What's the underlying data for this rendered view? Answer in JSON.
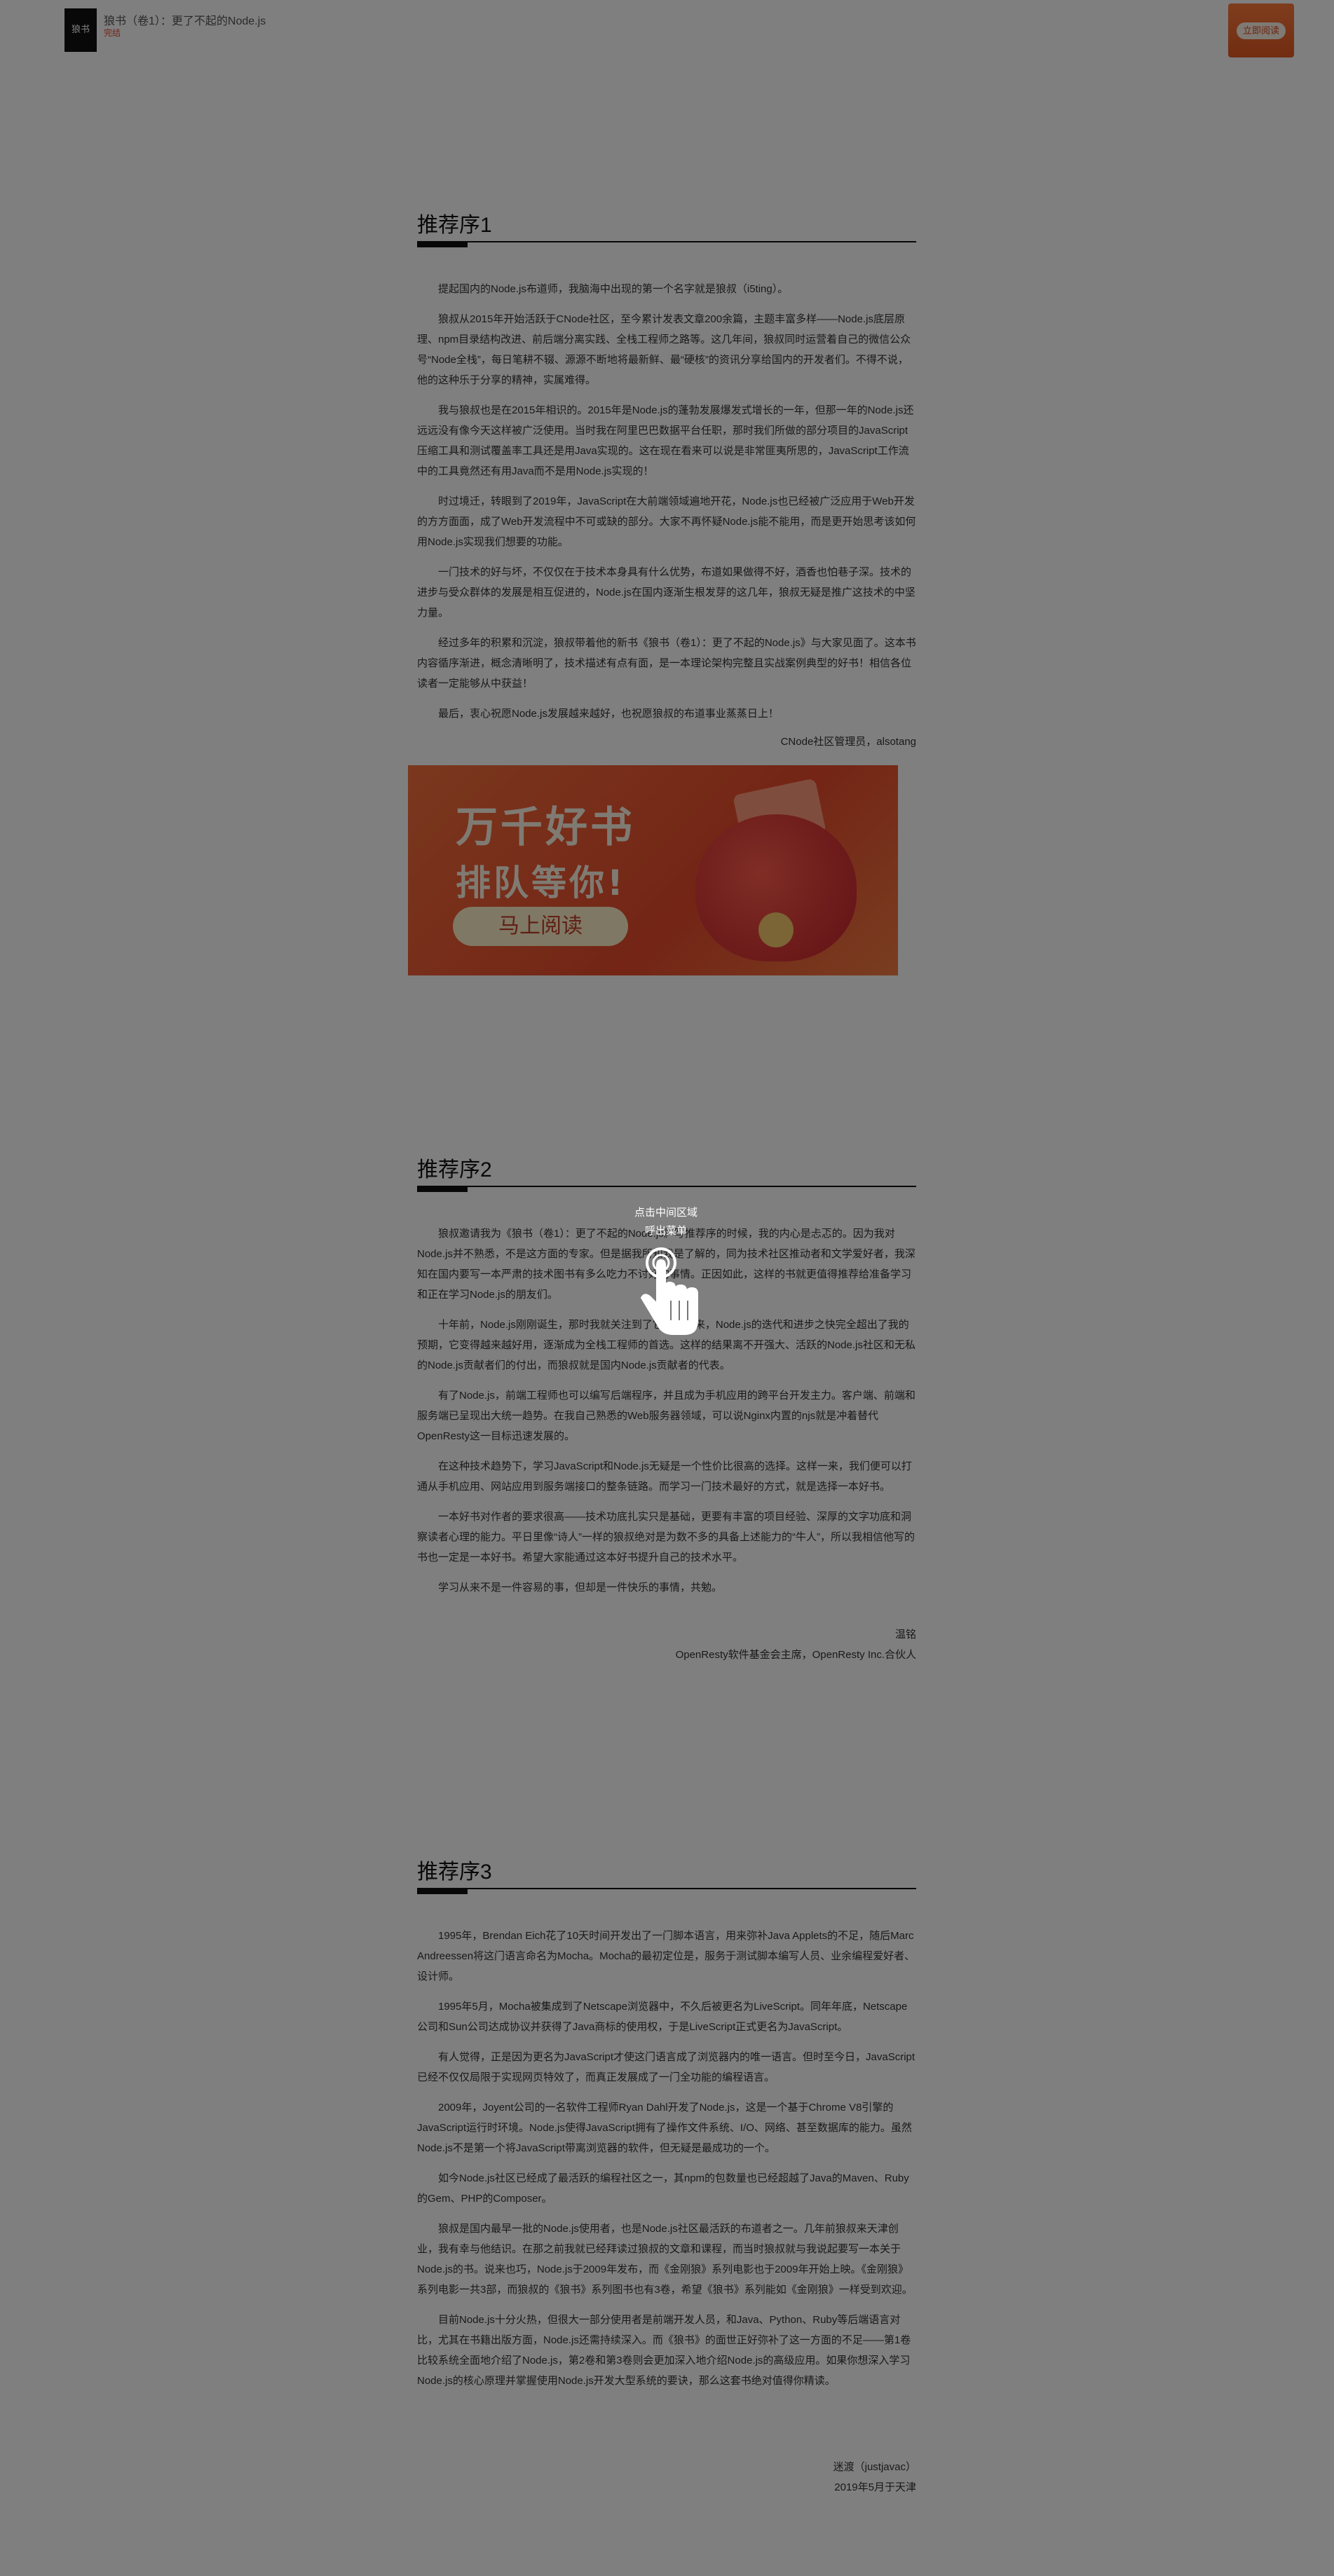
{
  "header": {
    "cover_text": "狼书",
    "title": "狼书（卷1）：更了不起的Node.js",
    "tag": "完结",
    "read_button": "立即阅读"
  },
  "sections": [
    {
      "heading": "推荐序1",
      "paragraphs": [
        "提起国内的Node.js布道师，我脑海中出现的第一个名字就是狼叔（i5ting）。",
        "狼叔从2015年开始活跃于CNode社区，至今累计发表文章200余篇，主题丰富多样——Node.js底层原理、npm目录结构改进、前后端分离实践、全栈工程师之路等。这几年间，狼叔同时运营着自己的微信公众号“Node全栈”，每日笔耕不辍、源源不断地将最新鲜、最“硬核”的资讯分享给国内的开发者们。不得不说，他的这种乐于分享的精神，实属难得。",
        "我与狼叔也是在2015年相识的。2015年是Node.js的蓬勃发展爆发式增长的一年，但那一年的Node.js还远远没有像今天这样被广泛使用。当时我在阿里巴巴数据平台任职，那时我们所做的部分项目的JavaScript压缩工具和测试覆盖率工具还是用Java实现的。这在现在看来可以说是非常匪夷所思的，JavaScript工作流中的工具竟然还有用Java而不是用Node.js实现的！",
        "时过境迁，转眼到了2019年，JavaScript在大前端领域遍地开花，Node.js也已经被广泛应用于Web开发的方方面面，成了Web开发流程中不可或缺的部分。大家不再怀疑Node.js能不能用，而是更开始思考该如何用Node.js实现我们想要的功能。",
        "一门技术的好与坏，不仅仅在于技术本身具有什么优势，布道如果做得不好，酒香也怕巷子深。技术的进步与受众群体的发展是相互促进的，Node.js在国内逐渐生根发芽的这几年，狼叔无疑是推广这技术的中坚力量。",
        "经过多年的积累和沉淀，狼叔带着他的新书《狼书（卷1）：更了不起的Node.js》与大家见面了。这本书内容循序渐进，概念清晰明了，技术描述有点有面，是一本理论架构完整且实战案例典型的好书！相信各位读者一定能够从中获益！",
        "最后，衷心祝愿Node.js发展越来越好，也祝愿狼叔的布道事业蒸蒸日上！"
      ],
      "signature": [
        "CNode社区管理员，alsotang"
      ]
    },
    {
      "heading": "推荐序2",
      "paragraphs": [
        "狼叔邀请我为《狼书（卷1）：更了不起的Node.js》写推荐序的时候，我的内心是忐忑的。因为我对Node.js并不熟悉，不是这方面的专家。但是据我所知我是了解的，同为技术社区推动者和文学爱好者，我深知在国内要写一本严肃的技术图书有多么吃力不讨好的事情。正因如此，这样的书就更值得推荐给准备学习和正在学习Node.js的朋友们。",
        "十年前，Node.js刚刚诞生，那时我就关注到了它。十年来，Node.js的迭代和进步之快完全超出了我的预期，它变得越来越好用，逐渐成为全栈工程师的首选。这样的结果离不开强大、活跃的Node.js社区和无私的Node.js贡献者们的付出，而狼叔就是国内Node.js贡献者的代表。",
        "有了Node.js，前端工程师也可以编写后端程序，并且成为手机应用的跨平台开发主力。客户端、前端和服务端已呈现出大统一趋势。在我自己熟悉的Web服务器领域，可以说Nginx内置的njs就是冲着替代OpenResty这一目标迅速发展的。",
        "在这种技术趋势下，学习JavaScript和Node.js无疑是一个性价比很高的选择。这样一来，我们便可以打通从手机应用、网站应用到服务端接口的整条链路。而学习一门技术最好的方式，就是选择一本好书。",
        "一本好书对作者的要求很高——技术功底扎实只是基础，更要有丰富的项目经验、深厚的文字功底和洞察读者心理的能力。平日里像“诗人”一样的狼叔绝对是为数不多的具备上述能力的“牛人”，所以我相信他写的书也一定是一本好书。希望大家能通过这本好书提升自己的技术水平。",
        "学习从来不是一件容易的事，但却是一件快乐的事情，共勉。"
      ],
      "signature": [
        "温铭",
        "OpenResty软件基金会主席，OpenResty Inc.合伙人"
      ]
    },
    {
      "heading": "推荐序3",
      "paragraphs": [
        "1995年，Brendan Eich花了10天时间开发出了一门脚本语言，用来弥补Java Applets的不足，随后Marc Andreessen将这门语言命名为Mocha。Mocha的最初定位是，服务于测试脚本编写人员、业余编程爱好者、设计师。",
        "1995年5月，Mocha被集成到了Netscape浏览器中，不久后被更名为LiveScript。同年年底，Netscape公司和Sun公司达成协议并获得了Java商标的使用权，于是LiveScript正式更名为JavaScript。",
        "有人觉得，正是因为更名为JavaScript才使这门语言成了浏览器内的唯一语言。但时至今日，JavaScript已经不仅仅局限于实现网页特效了，而真正发展成了一门全功能的编程语言。",
        "2009年，Joyent公司的一名软件工程师Ryan Dahl开发了Node.js，这是一个基于Chrome V8引擎的JavaScript运行时环境。Node.js使得JavaScript拥有了操作文件系统、I/O、网络、甚至数据库的能力。虽然Node.js不是第一个将JavaScript带离浏览器的软件，但无疑是最成功的一个。",
        "如今Node.js社区已经成了最活跃的编程社区之一，其npm的包数量也已经超越了Java的Maven、Ruby的Gem、PHP的Composer。",
        "狼叔是国内最早一批的Node.js使用者，也是Node.js社区最活跃的布道者之一。几年前狼叔来天津创业，我有幸与他结识。在那之前我就已经拜读过狼叔的文章和课程，而当时狼叔就与我说起要写一本关于Node.js的书。说来也巧，Node.js于2009年发布，而《金刚狼》系列电影也于2009年开始上映。《金刚狼》系列电影一共3部，而狼叔的《狼书》系列图书也有3卷，希望《狼书》系列能如《金刚狼》一样受到欢迎。",
        "目前Node.js十分火热，但很大一部分使用者是前端开发人员，和Java、Python、Ruby等后端语言对比，尤其在书籍出版方面，Node.js还需持续深入。而《狼书》的面世正好弥补了这一方面的不足——第1卷比较系统全面地介绍了Node.js，第2卷和第3卷则会更加深入地介绍Node.js的高级应用。如果你想深入学习Node.js的核心原理并掌握使用Node.js开发大型系统的要诀，那么这套书绝对值得你精读。"
      ],
      "signature": [
        "迷渡（justjavac）",
        "2019年5月于天津"
      ]
    }
  ],
  "banner": {
    "line1": "万千好书",
    "line2": "排队等你!",
    "button": "马上阅读"
  },
  "overlay": {
    "hint_line1": "点击中间区域",
    "hint_line2": "呼出菜单"
  }
}
